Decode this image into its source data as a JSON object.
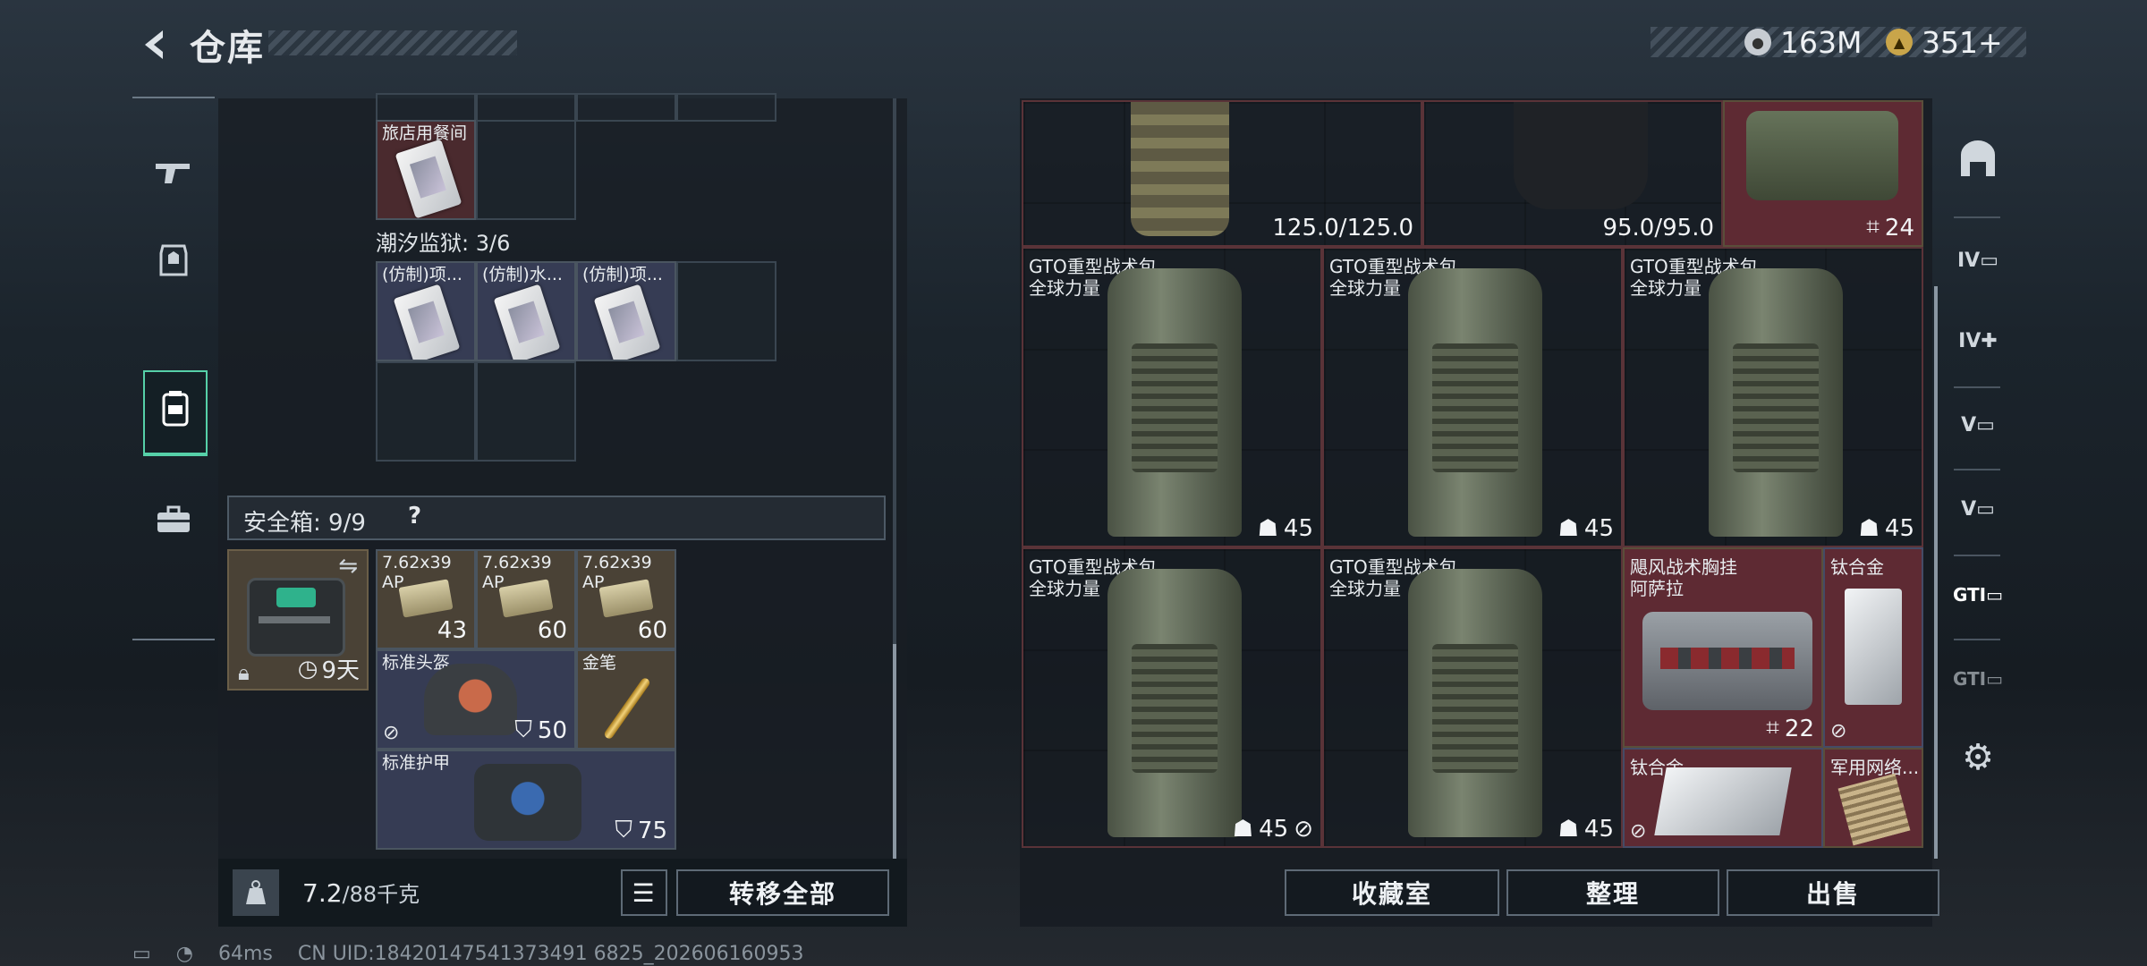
{
  "header": {
    "title": "仓库",
    "back_icon": "back-chevron-icon"
  },
  "currency": {
    "silver": "163M",
    "gold": "351+"
  },
  "left_nav": [
    {
      "icon": "gun-icon"
    },
    {
      "icon": "armor-icon"
    },
    {
      "icon": "backpack-icon",
      "active": true
    },
    {
      "icon": "briefcase-icon"
    }
  ],
  "left_panel": {
    "item_hotel_label": "旅店用餐间",
    "tidal_prison_label": "潮汐监狱: 3/6",
    "tidal_items": [
      "(仿制)项...",
      "(仿制)水...",
      "(仿制)项..."
    ],
    "safe_box_label": "安全箱: 9/9",
    "safe_help": "?",
    "safe_case_days": "9天",
    "ammo": [
      {
        "name": "7.62x39",
        "sub": "AP",
        "count": "43"
      },
      {
        "name": "7.62x39",
        "sub": "AP",
        "count": "60"
      },
      {
        "name": "7.62x39",
        "sub": "AP",
        "count": "60"
      }
    ],
    "helmet": {
      "name": "标准头盔",
      "durability": "50"
    },
    "gold_pen": {
      "name": "金笔"
    },
    "armor": {
      "name": "标准护甲",
      "durability": "75"
    },
    "weight": "7.2",
    "weight_max": "/88千克",
    "transfer_all": "转移全部"
  },
  "stash": {
    "top_row": [
      {
        "value": "125.0/125.0"
      },
      {
        "value": "95.0/95.0"
      },
      {
        "value": "24"
      }
    ],
    "backpacks": [
      {
        "name": "GTO重型战术包",
        "sub": "全球力量",
        "durability": "45"
      },
      {
        "name": "GTO重型战术包",
        "sub": "全球力量",
        "durability": "45"
      },
      {
        "name": "GTO重型战术包",
        "sub": "全球力量",
        "durability": "45"
      },
      {
        "name": "GTO重型战术包",
        "sub": "全球力量",
        "durability": "45"
      },
      {
        "name": "GTO重型战术包",
        "sub": "全球力量",
        "durability": "45"
      }
    ],
    "rig": {
      "name": "飓风战术胸挂",
      "sub": "阿萨拉",
      "value": "22"
    },
    "titanium1": {
      "name": "钛合金"
    },
    "titanium2": {
      "name": "钛合金"
    },
    "network": {
      "name": "军用网络..."
    }
  },
  "buttons": {
    "collection": "收藏室",
    "sort": "整理",
    "sell": "出售"
  },
  "status": {
    "ping": "64ms",
    "uid": "CN UID:18420147541373491 6825_202606160953"
  },
  "colors": {
    "accent": "#56d0a8",
    "red_bg": "#5e2a33",
    "blue_bg": "#363c54",
    "tan_bg": "#4a4236"
  }
}
